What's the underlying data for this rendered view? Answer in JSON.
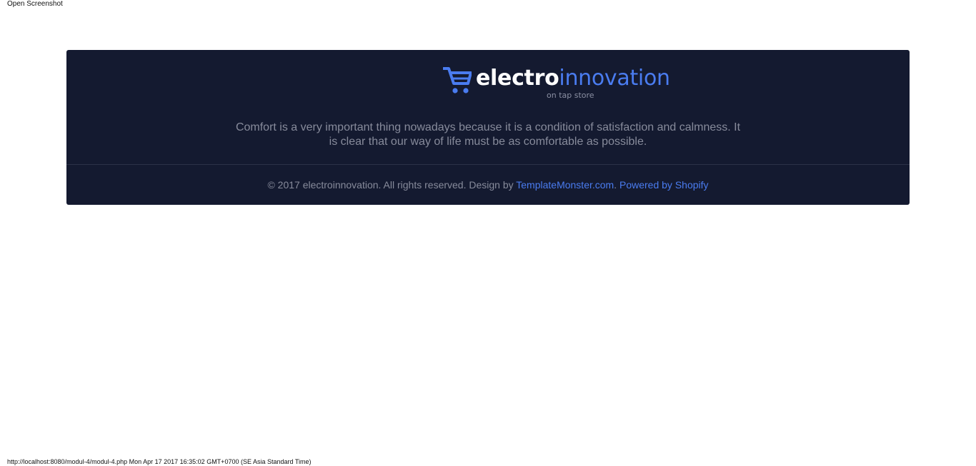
{
  "header": {
    "open_screenshot_label": "Open Screenshot"
  },
  "footer": {
    "logo": {
      "word_primary": "electro",
      "word_accent": "innovation",
      "tagline": "on tap store",
      "icon": "shopping-cart-icon"
    },
    "about_text": "Comfort is a very important thing nowadays because it is a condition of satisfaction and calmness. It is clear that our way of life must be as comfortable as possible.",
    "copyright": {
      "prefix": "© 2017 electroinnovation. All rights reserved. Design by ",
      "design_link": "TemplateMonster.com",
      "separator": ". ",
      "powered_link": "Powered by Shopify"
    }
  },
  "status_bar": {
    "text": "http://localhost:8080/modul-4/modul-4.php Mon Apr 17 2017 16:35:02 GMT+0700 (SE Asia Standard Time)"
  },
  "colors": {
    "card_background": "#141a30",
    "accent": "#4a7cf0",
    "muted_text": "#878b9b",
    "logo_white": "#ffffff"
  }
}
